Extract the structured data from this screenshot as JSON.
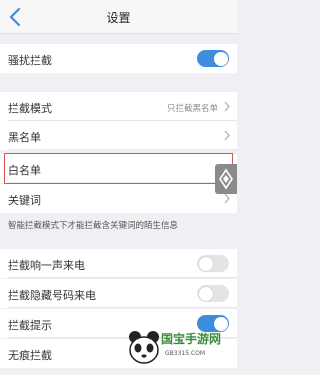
{
  "header": {
    "title": "设置"
  },
  "rows": {
    "harass_block": {
      "label": "骚扰拦截",
      "toggle": true
    },
    "block_mode": {
      "label": "拦截模式",
      "value": "只拦截黑名单"
    },
    "blacklist": {
      "label": "黑名单"
    },
    "whitelist": {
      "label": "白名单"
    },
    "keywords": {
      "label": "关键词"
    },
    "one_ring": {
      "label": "拦截响一声来电",
      "toggle": false
    },
    "hidden_number": {
      "label": "拦截隐藏号码来电",
      "toggle": false
    },
    "block_notice": {
      "label": "拦截提示",
      "toggle": true
    },
    "silent_block": {
      "label": "无痕拦截"
    }
  },
  "info_text": "智能拦截模式下才能拦截含关键词的陌生信息",
  "colors": {
    "accent": "#3e8ddc",
    "highlight": "#d9534f",
    "background": "#efeff4"
  },
  "watermark": {
    "brand": "国宝手游网",
    "url": "GB3315.COM"
  }
}
